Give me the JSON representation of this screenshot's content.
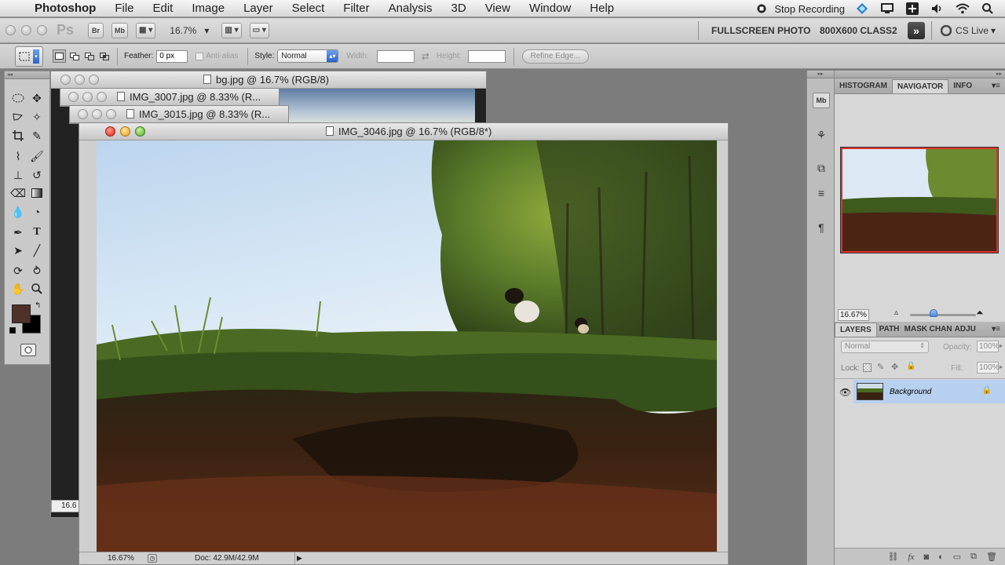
{
  "menubar": {
    "apple_glyph": "",
    "items": [
      "Photoshop",
      "File",
      "Edit",
      "Image",
      "Layer",
      "Select",
      "Filter",
      "Analysis",
      "3D",
      "View",
      "Window",
      "Help"
    ],
    "stop_recording": "Stop Recording"
  },
  "appbar": {
    "logo": "Ps",
    "bridge": "Br",
    "minibridge": "Mb",
    "zoom": "16.7%",
    "workspace_1": "FULLSCREEN PHOTO",
    "workspace_2": "800X600 CLASS2",
    "cs_live": "CS Live"
  },
  "options": {
    "feather_label": "Feather:",
    "feather_value": "0 px",
    "antialias_label": "Anti-alias",
    "style_label": "Style:",
    "style_value": "Normal",
    "width_label": "Width:",
    "height_label": "Height:",
    "refine_edge": "Refine Edge..."
  },
  "documents": {
    "back1_title": "bg.jpg @ 16.7% (RGB/8)",
    "back2_title": "IMG_3007.jpg @ 8.33% (R...",
    "back3_title": "IMG_3015.jpg @ 8.33% (R...",
    "active_title": "IMG_3046.jpg @ 16.7% (RGB/8*)",
    "back_zoom": "16.6",
    "status_zoom": "16.67%",
    "status_doc": "Doc: 42.9M/42.9M"
  },
  "panels": {
    "top_tabs": [
      "HISTOGRAM",
      "NAVIGATOR",
      "INFO"
    ],
    "active_top_tab": "NAVIGATOR",
    "nav_zoom": "16.67%",
    "layer_tabs": [
      "LAYERS",
      "PATH",
      "MASK",
      "CHAN",
      "ADJU"
    ],
    "blend_mode": "Normal",
    "opacity_label": "Opacity:",
    "opacity_value": "100%",
    "lock_label": "Lock:",
    "fill_label": "Fill:",
    "fill_value": "100%",
    "layer_name": "Background"
  }
}
